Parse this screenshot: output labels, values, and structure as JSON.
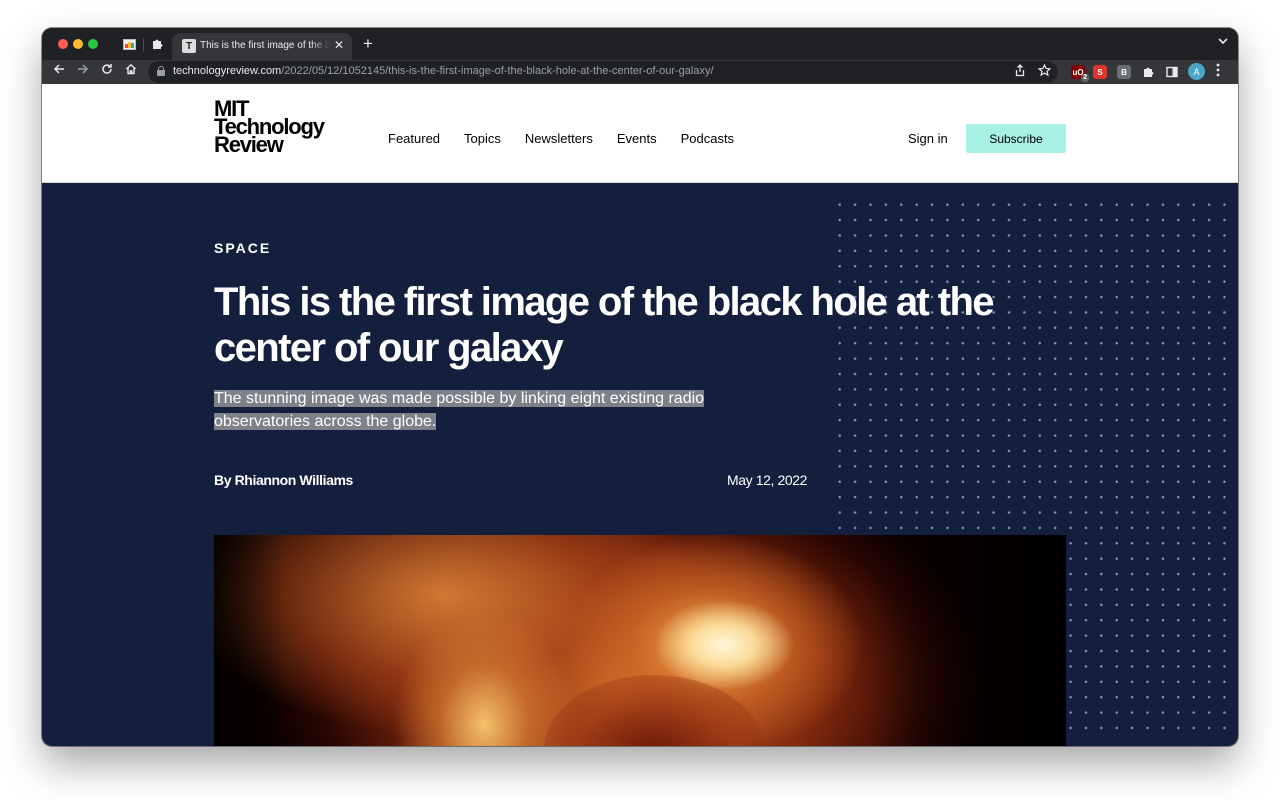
{
  "browser": {
    "tab": {
      "title": "This is the first image of the black hole at the center of our galaxy",
      "favicon_letter": "T",
      "close_glyph": "✕"
    },
    "new_tab_glyph": "+",
    "tab_menu_glyph": "⌄",
    "url": {
      "host": "technologyreview.com",
      "path": "/2022/05/12/1052145/this-is-the-first-image-of-the-black-hole-at-the-center-of-our-galaxy/"
    },
    "extensions": [
      {
        "name": "ublock-icon",
        "label": "uO",
        "color": "#800000",
        "badge": "2"
      },
      {
        "name": "s-extension-icon",
        "label": "S",
        "color": "#e0332d"
      },
      {
        "name": "b-extension-icon",
        "label": "B",
        "color": "#6b6e72"
      }
    ],
    "profile_initial": "A"
  },
  "site": {
    "logo_lines": [
      "MIT",
      "Technology",
      "Review"
    ],
    "nav": [
      "Featured",
      "Topics",
      "Newsletters",
      "Events",
      "Podcasts"
    ],
    "sign_in": "Sign in",
    "subscribe": "Subscribe"
  },
  "article": {
    "kicker": "SPACE",
    "headline": "This is the first image of the black hole at the center of our galaxy",
    "dek": "The stunning image was made possible by linking eight existing radio observatories across the globe.",
    "byline": "By Rhiannon Williams",
    "date": "May 12, 2022"
  },
  "colors": {
    "hero_background": "#131f3d",
    "subscribe_button": "#a8f0e3",
    "dek_highlight": "#7e818a"
  }
}
